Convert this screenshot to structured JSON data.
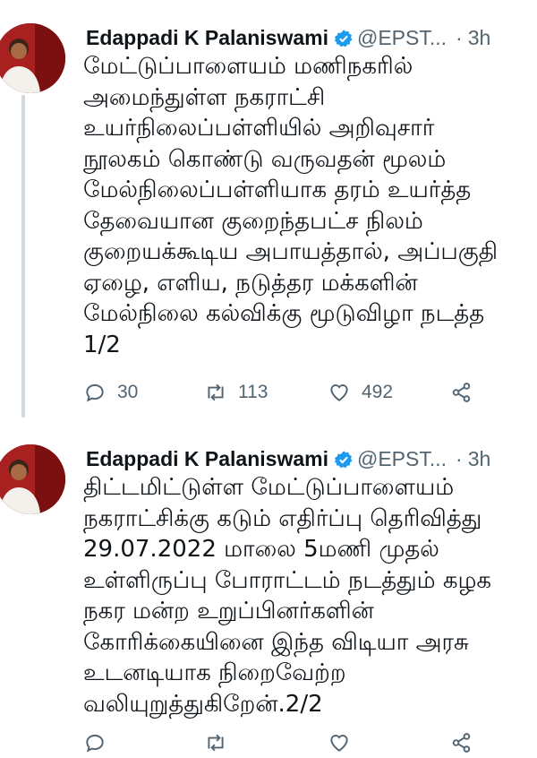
{
  "tweets": [
    {
      "author_name": "Edappadi K Palaniswami",
      "handle": "@EPST...",
      "separator": "·",
      "time": "3h",
      "lines": [
        "மேட்டுப்பாளையம் மணிநகரில்",
        "அமைந்துள்ள நகராட்சி",
        "உயர்நிலைப்பள்ளியில் அறிவுசார்",
        "நூலகம் கொண்டு வருவதன் மூலம்",
        "மேல்நிலைப்பள்ளியாக தரம் உயர்த்த",
        "தேவையான குறைந்தபட்ச நிலம்",
        "குறையக்கூடிய அபாயத்தால், அப்பகுதி",
        "ஏழை, எளிய, நடுத்தர மக்களின்",
        "மேல்நிலை கல்விக்கு மூடுவிழா நடத்த",
        "1/2"
      ],
      "replies": "30",
      "retweets": "113",
      "likes": "492"
    },
    {
      "author_name": "Edappadi K Palaniswami",
      "handle": "@EPST...",
      "separator": "·",
      "time": "3h",
      "lines": [
        "திட்டமிட்டுள்ள மேட்டுப்பாளையம்",
        "நகராட்சிக்கு கடும் எதிர்ப்பு தெரிவித்து",
        "29.07.2022 மாலை 5மணி முதல்",
        "உள்ளிருப்பு போராட்டம் நடத்தும் கழக",
        "நகர மன்ற உறுப்பினர்களின்",
        "கோரிக்கையினை இந்த விடியா அரசு",
        "உடனடியாக நிறைவேற்ற",
        "வலியுறுத்துகிறேன்.2/2"
      ]
    }
  ],
  "icons": {
    "verified": "verified-badge-icon",
    "reply": "reply-icon",
    "retweet": "retweet-icon",
    "like": "heart-icon",
    "share": "share-icon"
  },
  "colors": {
    "text": "#0f1419",
    "muted": "#536471",
    "verified": "#1d9bf0",
    "thread_line": "#cfd9de"
  }
}
